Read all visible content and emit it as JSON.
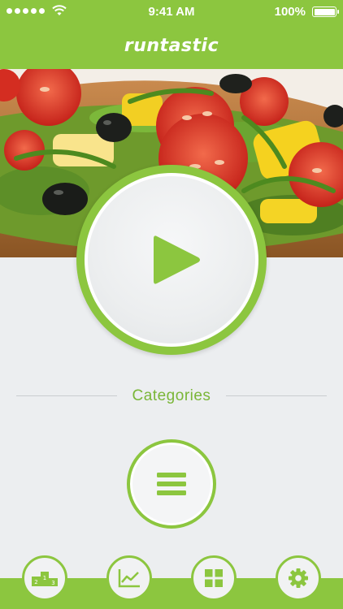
{
  "status_bar": {
    "time": "9:41 AM",
    "battery": "100%"
  },
  "header": {
    "logo": "runtastic"
  },
  "main": {
    "categories_label": "Categories"
  },
  "icons": {
    "play": "play-icon",
    "menu": "hamburger-menu-icon",
    "leaderboard": "podium-icon",
    "statistics": "line-chart-icon",
    "grid": "grid-icon",
    "settings": "gear-icon"
  },
  "colors": {
    "accent": "#8cc63f",
    "background": "#eceef0"
  }
}
